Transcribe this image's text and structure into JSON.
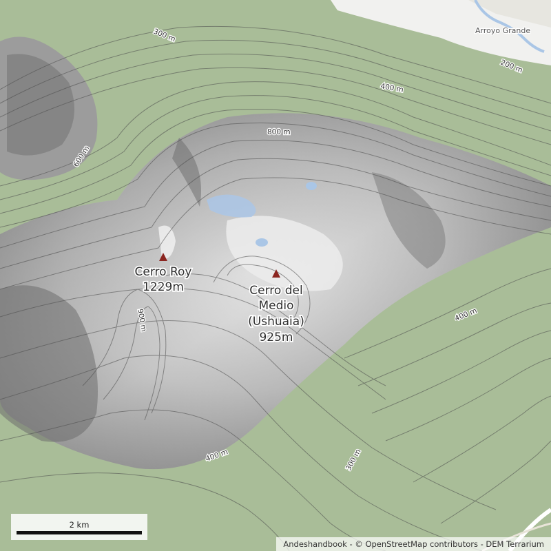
{
  "map": {
    "peaks": [
      {
        "name": "Cerro Roy",
        "elevation": "1229m"
      },
      {
        "name_lines": [
          "Cerro del",
          "Medio",
          "(Ushuaia)"
        ],
        "elevation": "925m"
      }
    ],
    "contour_labels": [
      "300 m",
      "200 m",
      "400 m",
      "800 m",
      "600 m",
      "900 m",
      "400 m",
      "400 m",
      "300 m"
    ],
    "place_labels": [
      "Arroyo Grande"
    ],
    "scale_bar": {
      "label": "2 km"
    },
    "attribution": "Andeshandbook - © OpenStreetMap contributors - DEM Terrarium",
    "colors": {
      "forest": "#9fb48f",
      "rock": "#d2d2d2",
      "snow": "#eeeeee",
      "water": "#aac6e6",
      "contour": "#4a4a4a",
      "peak_marker": "#8b2520"
    }
  }
}
